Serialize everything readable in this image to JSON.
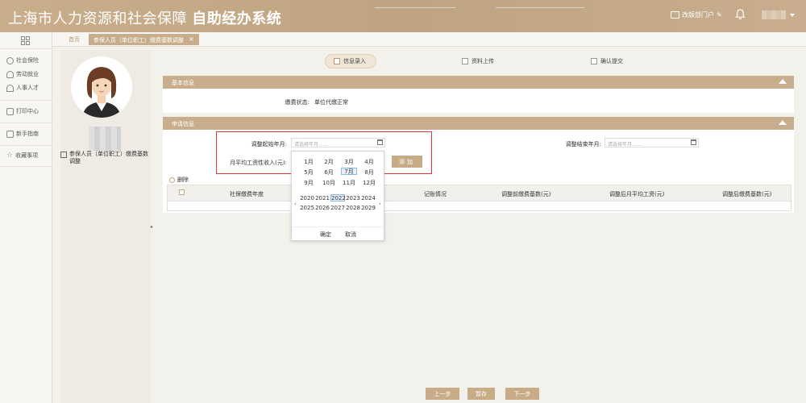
{
  "header": {
    "title": "上海市人力资源和社会保障",
    "title_bold": "自助经办系统",
    "dept_label": "改版部门户"
  },
  "leftnav": {
    "items": [
      {
        "label": "社会保险",
        "icon": "shield-icon"
      },
      {
        "label": "劳动就业",
        "icon": "user-icon"
      },
      {
        "label": "人事人才",
        "icon": "person-icon"
      },
      {
        "label": "打印中心",
        "icon": "printer-icon"
      },
      {
        "label": "新手指南",
        "icon": "book-icon"
      },
      {
        "label": "收藏事项",
        "icon": "star-icon"
      }
    ]
  },
  "tabs": {
    "home": "首页",
    "active": "参保人员（单位职工）缴费基数调整",
    "close": "×"
  },
  "profile": {
    "role": "参保人员（单位职工）缴费基数调整"
  },
  "steps": [
    {
      "label": "信息录入",
      "active": true
    },
    {
      "label": "资料上传",
      "active": false
    },
    {
      "label": "确认提交",
      "active": false
    }
  ],
  "basic": {
    "title": "基本信息",
    "status_label": "缴费状态:",
    "status_value": "单位代缴正常"
  },
  "apply": {
    "title": "申请信息",
    "start_label": "调整起始年月:",
    "start_placeholder": "请选择年月......",
    "end_label": "调整结束年月:",
    "end_placeholder": "请选择年月......",
    "income_label": "月平均工资性收入(元):",
    "add_button": "添加"
  },
  "table": {
    "delete_label": "删除",
    "headers": [
      "社保缴费年度",
      "记账情况",
      "调整前缴费基数(元)",
      "调整后月平均工资(元)",
      "调整后缴费基数(元)"
    ]
  },
  "picker": {
    "months": [
      "1月",
      "2月",
      "3月",
      "4月",
      "5月",
      "6月",
      "7月",
      "8月",
      "9月",
      "10月",
      "11月",
      "12月"
    ],
    "selected_month": "7月",
    "years": [
      "2020",
      "2021",
      "2022",
      "2023",
      "2024",
      "2025",
      "2026",
      "2027",
      "2028",
      "2029"
    ],
    "selected_year": "2022",
    "prev": "‹",
    "next": "›",
    "ok": "确定",
    "cancel": "取消"
  },
  "footer": {
    "prev": "上一步",
    "save": "暂存",
    "next": "下一步"
  },
  "colors": {
    "brand": "#c8ae8c",
    "highlight": "#e1353b"
  }
}
